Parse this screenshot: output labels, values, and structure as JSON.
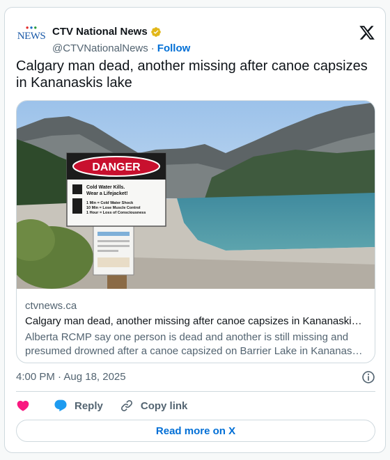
{
  "author": {
    "logo_top": "CTV",
    "logo_bottom": "NEWS",
    "display_name": "CTV National News",
    "handle": "@CTVNationalNews",
    "separator": "·",
    "follow_label": "Follow",
    "verified_badge_color": "#e2b719"
  },
  "tweet": {
    "text": "Calgary man dead, another missing after canoe capsizes in Kananaskis lake"
  },
  "link_card": {
    "image": {
      "sign_header": "DANGER",
      "sign_line1": "Cold Water Kills.",
      "sign_line2": "Wear a Lifejacket!",
      "sign_rule1": "1 Min = Cold Water Shock",
      "sign_rule2": "10 Min = Lose Muscle Control",
      "sign_rule3": "1 Hour = Loss of Consciousness"
    },
    "domain": "ctvnews.ca",
    "title": "Calgary man dead, another missing after canoe capsizes in Kananaski…",
    "description": "Alberta RCMP say one person is dead and another is still missing and presumed drowned after a canoe capsized on Barrier Lake in Kananas…"
  },
  "meta": {
    "timestamp": "4:00 PM · Aug 18, 2025"
  },
  "actions": {
    "like_label": "",
    "reply_label": "Reply",
    "copy_link_label": "Copy link"
  },
  "footer": {
    "read_more_label": "Read more on X"
  },
  "colors": {
    "accent": "#006fd6",
    "like": "#f91880",
    "reply": "#1d9bf0",
    "text_secondary": "#536471",
    "border": "#cfd9de"
  }
}
